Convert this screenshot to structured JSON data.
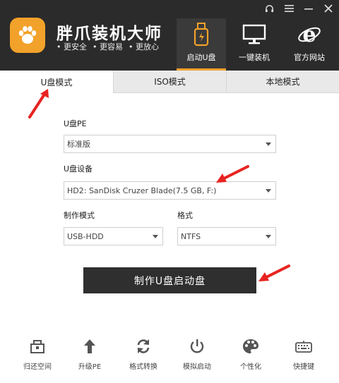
{
  "header": {
    "app_name": "胖爪装机大师",
    "slogans": [
      "更安全",
      "更容易",
      "更放心"
    ],
    "window_controls": [
      "headset-icon",
      "menu-icon",
      "minimize-icon",
      "close-icon"
    ],
    "nav": [
      {
        "label": "启动U盘",
        "icon": "usb-drive-icon",
        "active": true
      },
      {
        "label": "一键装机",
        "icon": "monitor-icon",
        "active": false
      },
      {
        "label": "官方网站",
        "icon": "ie-browser-icon",
        "active": false
      }
    ]
  },
  "tabs": [
    {
      "label": "U盘模式",
      "active": true
    },
    {
      "label": "ISO模式",
      "active": false
    },
    {
      "label": "本地模式",
      "active": false
    }
  ],
  "form": {
    "pe_label": "U盘PE",
    "pe_value": "标准版",
    "device_label": "U盘设备",
    "device_value": "HD2: SanDisk Cruzer Blade(7.5 GB, F:)",
    "mode_label": "制作模式",
    "mode_value": "USB-HDD",
    "format_label": "格式",
    "format_value": "NTFS"
  },
  "action": {
    "make_label": "制作U盘启动盘"
  },
  "toolbar": [
    {
      "label": "归还空间",
      "icon": "restore-space-icon"
    },
    {
      "label": "升级PE",
      "icon": "upgrade-arrow-icon"
    },
    {
      "label": "格式转换",
      "icon": "convert-icon"
    },
    {
      "label": "模拟启动",
      "icon": "power-icon"
    },
    {
      "label": "个性化",
      "icon": "palette-icon"
    },
    {
      "label": "快捷键",
      "icon": "keyboard-icon"
    }
  ],
  "colors": {
    "header_bg": "#2b2b2b",
    "accent": "#f2a22a",
    "button_bg": "#2f2f2f",
    "annotation_arrow": "#e8231f"
  }
}
